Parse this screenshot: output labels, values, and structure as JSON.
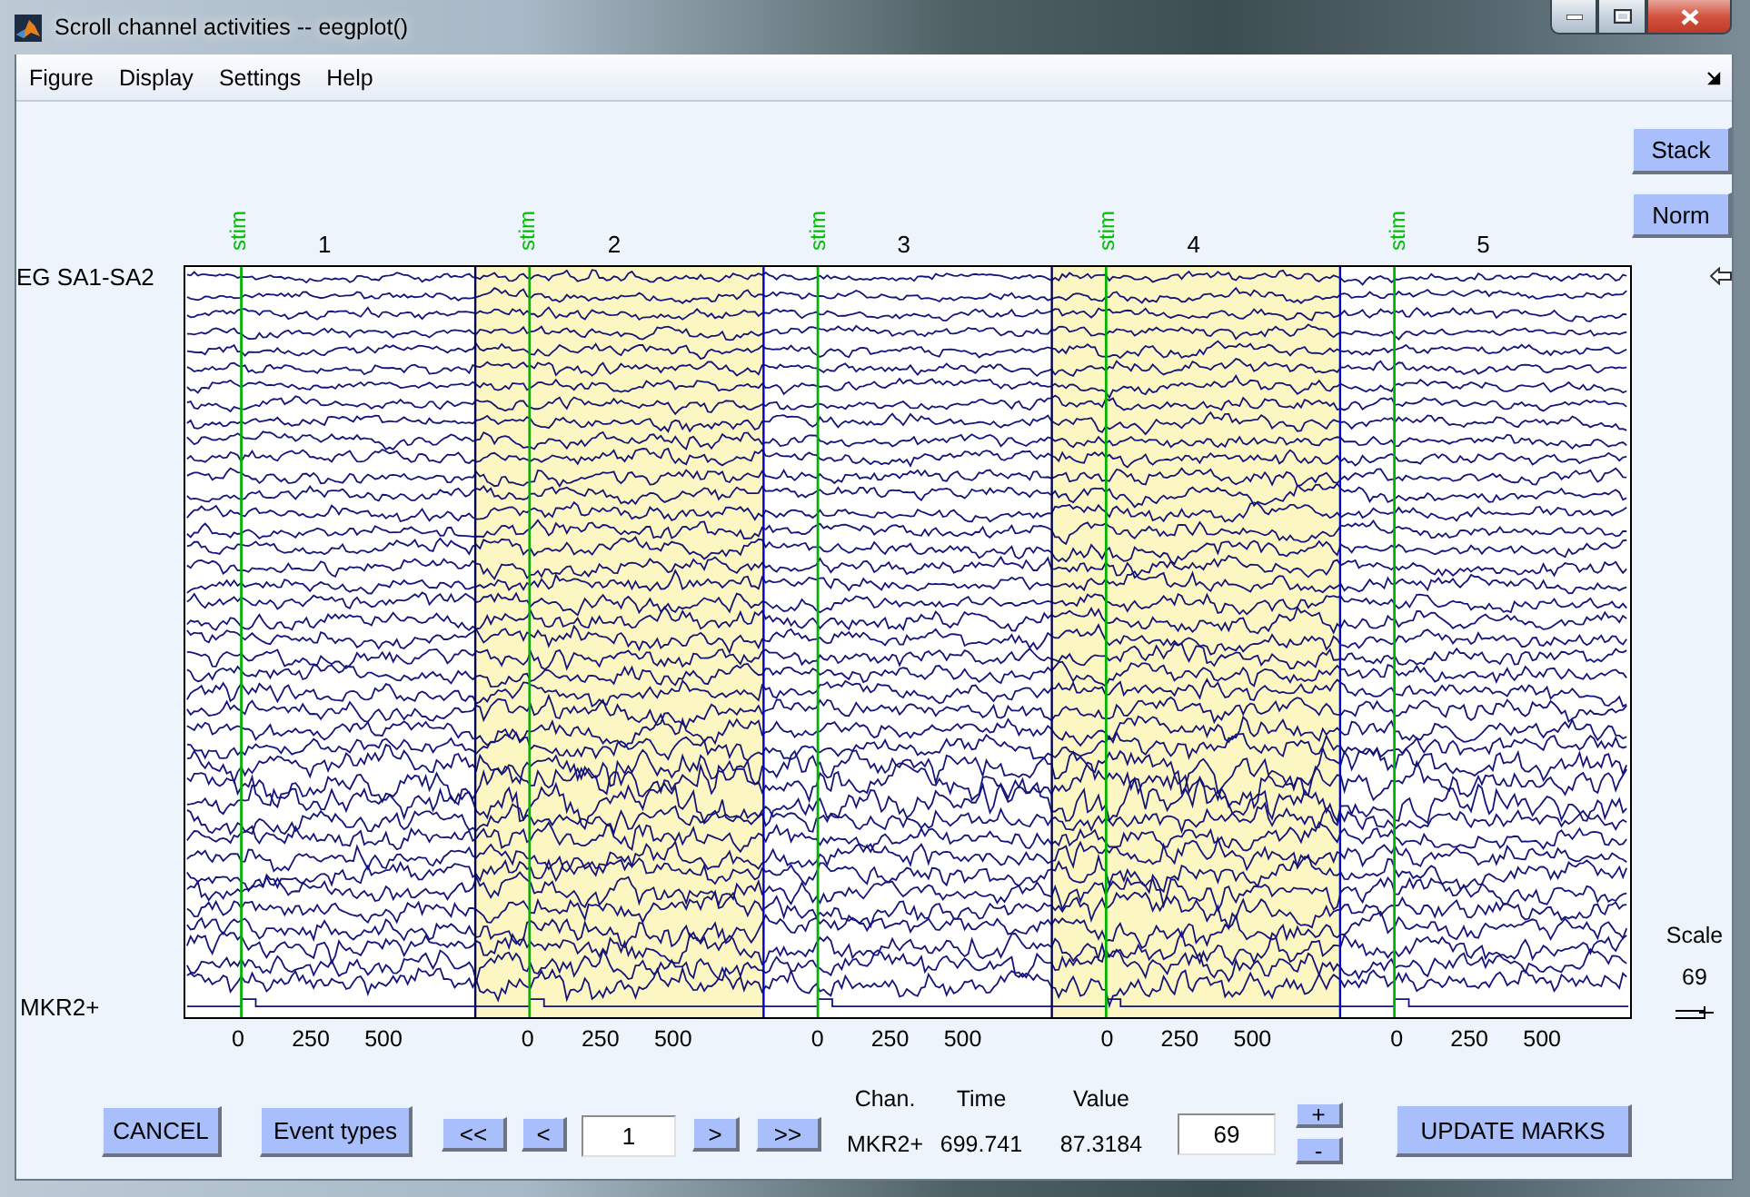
{
  "window": {
    "title": "Scroll channel activities -- eegplot()"
  },
  "menu": [
    "Figure",
    "Display",
    "Settings",
    "Help"
  ],
  "view_buttons": [
    "Stack",
    "Norm"
  ],
  "channel_labels": [
    "EG SA1-SA2",
    "MKR2+"
  ],
  "epochs": [
    {
      "number": "1",
      "event": "stim",
      "marked": false,
      "ticks": [
        "0",
        "250",
        "500"
      ]
    },
    {
      "number": "2",
      "event": "stim",
      "marked": true,
      "ticks": [
        "0",
        "250",
        "500"
      ]
    },
    {
      "number": "3",
      "event": "stim",
      "marked": false,
      "ticks": [
        "0",
        "250",
        "500"
      ]
    },
    {
      "number": "4",
      "event": "stim",
      "marked": true,
      "ticks": [
        "0",
        "250",
        "500"
      ]
    },
    {
      "number": "5",
      "event": "stim",
      "marked": false,
      "ticks": [
        "0",
        "250",
        "500"
      ]
    }
  ],
  "scale": {
    "label": "Scale",
    "value": "69"
  },
  "controls": {
    "cancel": "CANCEL",
    "event_types": "Event types",
    "back": [
      "<<",
      "<"
    ],
    "epoch_field": {
      "value": "1"
    },
    "forward": [
      ">",
      ">>"
    ],
    "readout": [
      {
        "heading": "Chan.",
        "value": "MKR2+"
      },
      {
        "heading": "Time",
        "value": "699.741"
      },
      {
        "heading": "Value",
        "value": "87.3184"
      }
    ],
    "scale_field": {
      "value": "69"
    },
    "steppers": [
      "+",
      "-"
    ],
    "update": "UPDATE MARKS"
  }
}
